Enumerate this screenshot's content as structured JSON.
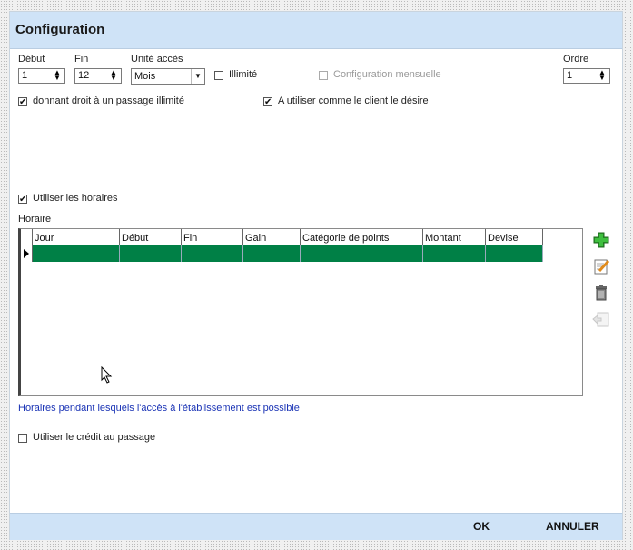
{
  "title": "Configuration",
  "fields": {
    "debut_label": "Début",
    "debut_value": "1",
    "fin_label": "Fin",
    "fin_value": "12",
    "unite_label": "Unité accès",
    "unite_value": "Mois",
    "illimite_label": "Illimité",
    "illimite_checked": false,
    "config_mensuelle_label": "Configuration mensuelle",
    "config_mensuelle_checked": false,
    "ordre_label": "Ordre",
    "ordre_value": "1"
  },
  "options": {
    "passage_illimite_label": "donnant droit à un passage illimité",
    "passage_illimite_checked": true,
    "client_desire_label": "A utiliser comme le client le désire",
    "client_desire_checked": true,
    "horaires_label": "Utiliser les horaires",
    "horaires_checked": true,
    "credit_label": "Utiliser le crédit au passage",
    "credit_checked": false
  },
  "grid": {
    "label": "Horaire",
    "columns": [
      "Jour",
      "Début",
      "Fin",
      "Gain",
      "Catégorie de points",
      "Montant",
      "Devise"
    ],
    "rows": [
      [
        "",
        "",
        "",
        "",
        "",
        "",
        ""
      ]
    ],
    "row_color": "#008046"
  },
  "side_icons": [
    "add-icon",
    "edit-icon",
    "delete-icon",
    "export-icon"
  ],
  "info_text": "Horaires pendant lesquels l'accès à l'établissement est possible",
  "footer": {
    "ok_label": "OK",
    "cancel_label": "ANNULER"
  },
  "colors": {
    "header_bg": "#cfe3f7",
    "info_text": "#1a33b5"
  }
}
